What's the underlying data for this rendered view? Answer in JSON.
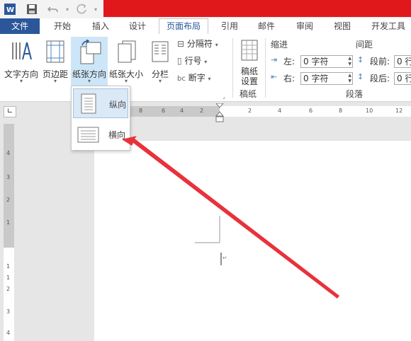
{
  "quick_access": {
    "app_icon": "word-icon",
    "save_icon": "save-icon",
    "undo_icon": "undo-icon",
    "redo_icon": "redo-icon"
  },
  "tabs": [
    {
      "label": "文件"
    },
    {
      "label": "开始"
    },
    {
      "label": "插入"
    },
    {
      "label": "设计"
    },
    {
      "label": "页面布局"
    },
    {
      "label": "引用"
    },
    {
      "label": "邮件"
    },
    {
      "label": "审阅"
    },
    {
      "label": "视图"
    },
    {
      "label": "开发工具"
    }
  ],
  "ribbon": {
    "text_direction": "文字方向",
    "margins": "页边距",
    "orientation": "纸张方向",
    "size": "纸张大小",
    "columns": "分栏",
    "breaks": "分隔符",
    "line_numbers": "行号",
    "hyphenation": "断字",
    "manuscript_line1": "稿纸",
    "manuscript_line2": "设置",
    "manuscript_group": "稿纸",
    "indent_title": "缩进",
    "spacing_title": "间距",
    "left_label": "左:",
    "right_label": "右:",
    "left_value": "0 字符",
    "right_value": "0 字符",
    "before_label": "段前:",
    "after_label": "段后:",
    "before_value": "0 行",
    "after_value": "0 行",
    "paragraph_group": "段落"
  },
  "orientation_menu": {
    "portrait": "纵向",
    "landscape": "横向"
  },
  "hruler_ticks": [
    "8",
    "6",
    "4",
    "2",
    "2",
    "4",
    "6",
    "8",
    "10",
    "12"
  ],
  "vruler_ticks": [
    "4",
    "3",
    "2",
    "1",
    "1",
    "1",
    "2",
    "3",
    "4"
  ],
  "colors": {
    "accent": "#2b579a",
    "title_red": "#e0181b",
    "arrow": "#e8323b"
  }
}
